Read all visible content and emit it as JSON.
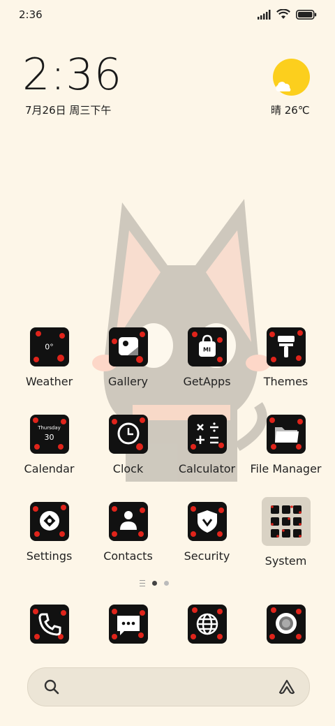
{
  "status_bar": {
    "time": "2:36"
  },
  "clock_widget": {
    "time": "2:36",
    "date": "7月26日 周三下午"
  },
  "weather_widget": {
    "text": "晴 26℃",
    "icon": "sunny-cloud-icon"
  },
  "apps": [
    {
      "label": "Weather",
      "icon": "weather-icon",
      "sub": "0°"
    },
    {
      "label": "Gallery",
      "icon": "gallery-icon"
    },
    {
      "label": "GetApps",
      "icon": "getapps-bag-icon",
      "sub": "MI"
    },
    {
      "label": "Themes",
      "icon": "themes-brush-icon"
    },
    {
      "label": "Calendar",
      "icon": "calendar-icon",
      "sub": "Thursday",
      "sub2": "30"
    },
    {
      "label": "Clock",
      "icon": "clock-icon"
    },
    {
      "label": "Calculator",
      "icon": "calculator-icon"
    },
    {
      "label": "File Manager",
      "icon": "folder-icon"
    },
    {
      "label": "Settings",
      "icon": "settings-gear-icon"
    },
    {
      "label": "Contacts",
      "icon": "contacts-person-icon"
    },
    {
      "label": "Security",
      "icon": "security-shield-icon"
    },
    {
      "label": "System",
      "icon": "system-folder-icon"
    }
  ],
  "dock": [
    {
      "icon": "phone-icon"
    },
    {
      "icon": "messages-icon"
    },
    {
      "icon": "browser-globe-icon"
    },
    {
      "icon": "camera-icon"
    }
  ],
  "pager": {
    "pages": 2,
    "current": 1
  },
  "colors": {
    "background": "#fdf6e8",
    "sun": "#fccf1d",
    "heart": "#e0241b",
    "icon_bg": "#111111"
  }
}
